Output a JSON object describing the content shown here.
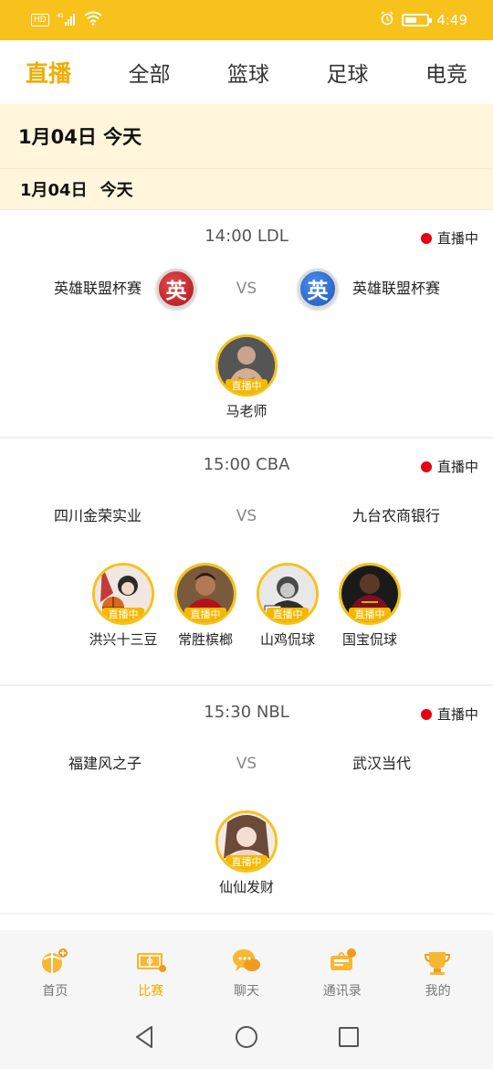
{
  "status_bar": {
    "hd": "HD",
    "network": "4G",
    "time": "4:49"
  },
  "tabs": [
    {
      "label": "直播",
      "active": true
    },
    {
      "label": "全部",
      "active": false
    },
    {
      "label": "篮球",
      "active": false
    },
    {
      "label": "足球",
      "active": false
    },
    {
      "label": "电竞",
      "active": false
    }
  ],
  "date_header": {
    "primary": "1月04日  今天",
    "secondary_date": "1月04日",
    "secondary_day": "今天"
  },
  "matches": [
    {
      "time_league": "14:00  LDL",
      "live_label": "直播中",
      "home": "英雄联盟杯赛",
      "away": "英雄联盟杯赛",
      "home_badge": "英",
      "away_badge": "英",
      "vs": "VS",
      "streamers": [
        {
          "name": "马老师",
          "tag": "直播中"
        }
      ]
    },
    {
      "time_league": "15:00  CBA",
      "live_label": "直播中",
      "home": "四川金荣实业",
      "away": "九台农商银行",
      "vs": "VS",
      "streamers": [
        {
          "name": "洪兴十三豆",
          "tag": "直播中"
        },
        {
          "name": "常胜槟榔",
          "tag": "直播中"
        },
        {
          "name": "山鸡侃球",
          "tag": "直播中"
        },
        {
          "name": "国宝侃球",
          "tag": "直播中"
        }
      ]
    },
    {
      "time_league": "15:30  NBL",
      "live_label": "直播中",
      "home": "福建风之子",
      "away": "武汉当代",
      "vs": "VS",
      "streamers": [
        {
          "name": "仙仙发财",
          "tag": "直播中"
        }
      ]
    }
  ],
  "bottom_nav": [
    {
      "label": "首页",
      "icon": "home-icon",
      "active": false
    },
    {
      "label": "比赛",
      "icon": "match-icon",
      "active": true
    },
    {
      "label": "聊天",
      "icon": "chat-icon",
      "active": false
    },
    {
      "label": "通讯录",
      "icon": "contacts-icon",
      "active": false
    },
    {
      "label": "我的",
      "icon": "profile-icon",
      "active": false
    }
  ],
  "colors": {
    "accent": "#f8c21c",
    "active_text": "#f0ad00",
    "live_dot": "#e60012",
    "banner_bg": "#fff6dc"
  }
}
